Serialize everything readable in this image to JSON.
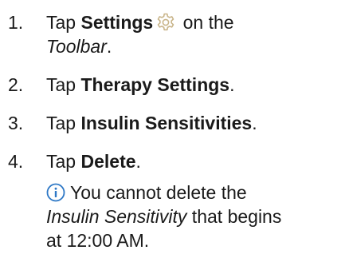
{
  "steps": [
    {
      "number": "1.",
      "line1_prefix": "Tap ",
      "line1_bold": "Settings",
      "icon": "gear-icon",
      "line1_suffix": " on the",
      "line2_italic": "Toolbar",
      "line2_suffix": "."
    },
    {
      "number": "2.",
      "prefix": "Tap ",
      "bold": "Therapy Settings",
      "suffix": "."
    },
    {
      "number": "3.",
      "prefix": "Tap ",
      "bold": "Insulin Sensitivities",
      "suffix": "."
    },
    {
      "number": "4.",
      "prefix": "Tap ",
      "bold": "Delete",
      "suffix": "."
    }
  ],
  "note": {
    "icon": "info-icon",
    "line1": "You cannot delete the",
    "line2_italic": "Insulin Sensitivity",
    "line2_suffix": " that begins",
    "line3": "at 12:00 AM."
  },
  "colors": {
    "text": "#1a1a1a",
    "gear_icon": "#c9b58a",
    "info_icon": "#2e78c6"
  }
}
